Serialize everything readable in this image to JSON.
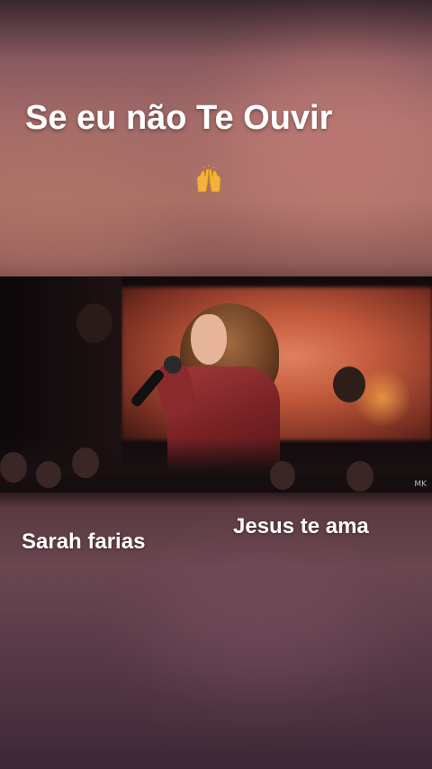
{
  "overlay": {
    "title": "Se eu não Te Ouvir",
    "emoji_icon": "raising-hands-icon",
    "caption_left": "Sarah farias",
    "caption_right": "Jesus te ama"
  },
  "video": {
    "watermark": "MK"
  },
  "colors": {
    "text": "#ffffff",
    "jacket": "#7a2225",
    "stage_screen": "#c25a3c"
  }
}
